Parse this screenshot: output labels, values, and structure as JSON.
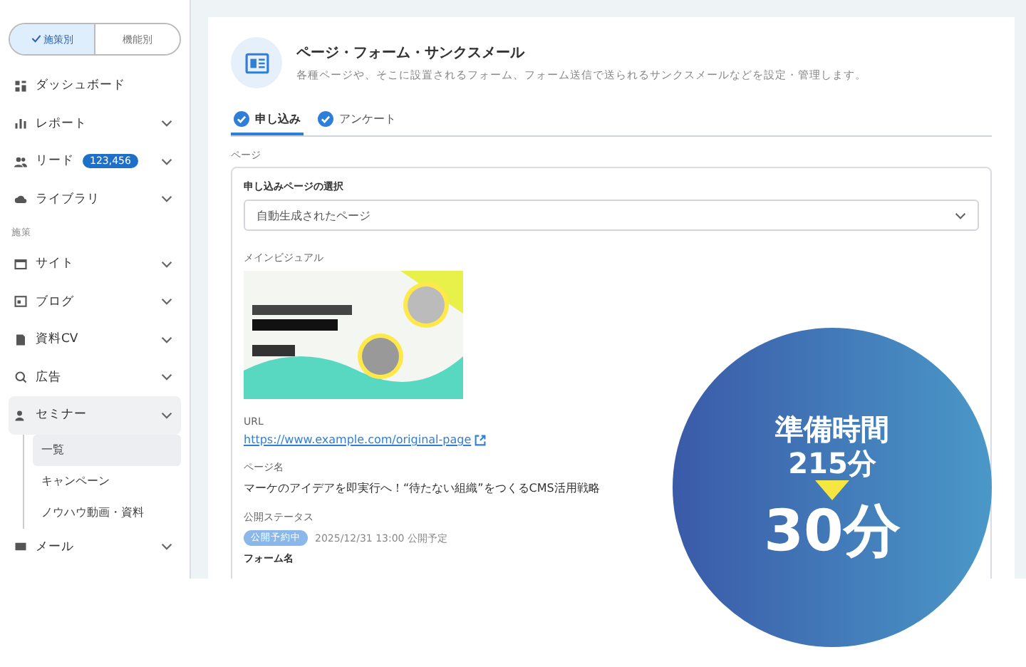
{
  "sidebar": {
    "view_toggle": [
      {
        "label": "施策別",
        "selected": true
      },
      {
        "label": "機能別",
        "selected": false
      }
    ],
    "sections": [
      {
        "items": [
          {
            "label": "ダッシュボード",
            "expandable": false
          },
          {
            "label": "レポート",
            "expandable": true
          },
          {
            "label": "リード",
            "badge": "123,456",
            "expandable": true
          },
          {
            "label": "ライブラリ",
            "expandable": true
          }
        ]
      },
      {
        "heading": "施策",
        "items": [
          {
            "label": "サイト",
            "expandable": true
          },
          {
            "label": "ブログ",
            "expandable": true
          },
          {
            "label": "資料CV",
            "expandable": true
          },
          {
            "label": "広告",
            "expandable": true
          },
          {
            "label": "セミナー",
            "expandable": true,
            "expanded": true,
            "children": [
              {
                "label": "一覧",
                "selected": true
              },
              {
                "label": "キャンペーン",
                "selected": false
              },
              {
                "label": "ノウハウ動画・資料",
                "selected": false
              }
            ]
          },
          {
            "label": "メール",
            "expandable": true
          }
        ]
      }
    ]
  },
  "header": {
    "title": "ページ・フォーム・サンクスメール",
    "description": "各種ページや、そこに設置されるフォーム、フォーム送信で送られるサンクスメールなどを設定・管理します。"
  },
  "tabs": [
    {
      "label": "申し込み",
      "checked": true,
      "selected": true
    },
    {
      "label": "アンケート",
      "checked": true,
      "selected": false
    }
  ],
  "section_label": "ページ",
  "page_card": {
    "select_label": "申し込みページの選択",
    "select_value": "自動生成されたページ",
    "main_visual_label": "メインビジュアル",
    "url_label": "URL",
    "url": "https://www.example.com/original-page",
    "page_name_label": "ページ名",
    "page_name": "マーケのアイデアを即実行へ！“待たない組織”をつくるCMS活用戦略",
    "status_label": "公開ステータス",
    "status_badge": "公開予約中",
    "status_text": "2025/12/31 13:00 公開予定",
    "form_name_label": "フォーム名"
  },
  "callout": {
    "label": "準備時間",
    "before": "215分",
    "after": "30分"
  }
}
